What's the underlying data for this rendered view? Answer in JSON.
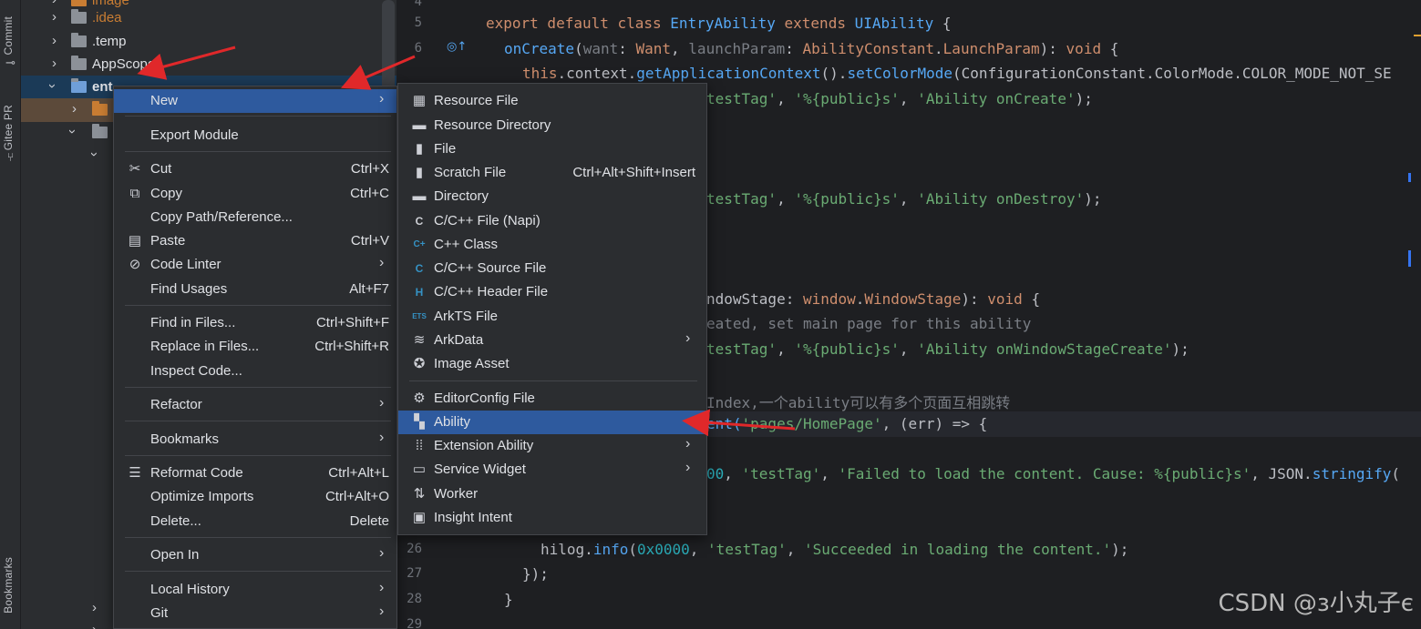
{
  "left_strip": {
    "commit_label": "Commit",
    "gitee_label": "Gitee PR",
    "bookmarks_label": "Bookmarks"
  },
  "project_tree": {
    "items": [
      {
        "label": "image",
        "indent": 1
      },
      {
        "label": ".idea",
        "indent": 1
      },
      {
        "label": ".temp",
        "indent": 1
      },
      {
        "label": "AppScope",
        "indent": 1
      },
      {
        "label": "ent",
        "indent": 1
      }
    ]
  },
  "editor": {
    "line_numbers": [
      "4",
      "5",
      "6",
      "26",
      "27",
      "28",
      "29"
    ],
    "lines": {
      "l5_kw": "export default class ",
      "l5_cls": "EntryAbility",
      "l5_ext": " extends ",
      "l5_base": "UIAbility",
      "l5_end": " {",
      "l6_fn": "onCreate",
      "l6_p1": "want",
      "l6_t1": "Want",
      "l6_p2": "launchParam",
      "l6_t2": "AbilityConstant",
      "l6_t2b": "LaunchParam",
      "l6_void": "void",
      "l7_this": "this",
      "l7_rest": ".context.",
      "l7_fn1": "getApplicationContext",
      "l7_mid": "().",
      "l7_fn2": "setColorMode",
      "l7_arg": "(ConfigurationConstant.ColorMode.COLOR_MODE_NOT_SE",
      "l8_s1": "testTag'",
      "l8_s2": "'%{public}s'",
      "l8_s3": "'Ability onCreate'",
      "l12_s1": "testTag'",
      "l12_s2": "'%{public}s'",
      "l12_s3": "'Ability onDestroy'",
      "l16_p": "ndowStage",
      "l16_t": "window",
      "l16_t2": "WindowStage",
      "l16_void": "void",
      "l17_cmt": "eated, set main page for this ability",
      "l18_s1": "testTag'",
      "l18_s2": "'%{public}s'",
      "l18_s3": "'Ability onWindowStageCreate'",
      "l20_cmt": "Index,一个ability可以有多个页面互相跳转",
      "l21_fn": "ent(",
      "l21_s": "'pages/HomePage'",
      "l21_end": ", (err) => {",
      "l23_num": "00",
      "l23_s1": "'testTag'",
      "l23_s2": "'Failed to load the content. Cause: %{public}s'",
      "l23_json": "JSON",
      "l23_fn": "stringify",
      "l26_obj": "hilog",
      "l26_fn": "info",
      "l26_num": "0x0000",
      "l26_s1": "'testTag'",
      "l26_s2": "'Succeeded in loading the content.'",
      "l27": "});",
      "l28": "}"
    }
  },
  "context_menu": {
    "items": [
      {
        "label": "New",
        "underline": "N",
        "shortcut": "",
        "submenu": true,
        "highlighted": true
      },
      {
        "label": "Export Module",
        "shortcut": ""
      },
      {
        "label": "Cut",
        "shortcut": "Ctrl+X",
        "icon": "scissors-icon"
      },
      {
        "label": "Copy",
        "shortcut": "Ctrl+C",
        "icon": "copy-icon"
      },
      {
        "label": "Copy Path/Reference...",
        "shortcut": ""
      },
      {
        "label": "Paste",
        "shortcut": "Ctrl+V",
        "icon": "clipboard-icon"
      },
      {
        "label": "Code Linter",
        "shortcut": "",
        "submenu": true,
        "icon": "linter-icon"
      },
      {
        "label": "Find Usages",
        "shortcut": "Alt+F7"
      },
      {
        "label": "Find in Files...",
        "shortcut": "Ctrl+Shift+F"
      },
      {
        "label": "Replace in Files...",
        "shortcut": "Ctrl+Shift+R"
      },
      {
        "label": "Inspect Code...",
        "shortcut": ""
      },
      {
        "label": "Refactor",
        "shortcut": "",
        "submenu": true
      },
      {
        "label": "Bookmarks",
        "shortcut": "",
        "submenu": true
      },
      {
        "label": "Reformat Code",
        "shortcut": "Ctrl+Alt+L",
        "icon": "reformat-icon"
      },
      {
        "label": "Optimize Imports",
        "shortcut": "Ctrl+Alt+O"
      },
      {
        "label": "Delete...",
        "shortcut": "Delete"
      },
      {
        "label": "Open In",
        "shortcut": "",
        "submenu": true
      },
      {
        "label": "Local History",
        "shortcut": "",
        "submenu": true
      },
      {
        "label": "Git",
        "shortcut": "",
        "submenu": true
      }
    ]
  },
  "new_submenu": {
    "items": [
      {
        "label": "Resource File",
        "shortcut": "",
        "icon": "resource-file-icon"
      },
      {
        "label": "Resource Directory",
        "shortcut": "",
        "icon": "folder-icon"
      },
      {
        "label": "File",
        "shortcut": "",
        "icon": "file-icon"
      },
      {
        "label": "Scratch File",
        "shortcut": "Ctrl+Alt+Shift+Insert",
        "icon": "scratch-file-icon"
      },
      {
        "label": "Directory",
        "shortcut": "",
        "icon": "folder-icon"
      },
      {
        "label": "C/C++ File (Napi)",
        "shortcut": "",
        "icon": "c-file-icon"
      },
      {
        "label": "C++ Class",
        "shortcut": "",
        "icon": "cpp-class-icon"
      },
      {
        "label": "C/C++ Source File",
        "shortcut": "",
        "icon": "c-source-icon"
      },
      {
        "label": "C/C++ Header File",
        "shortcut": "",
        "icon": "c-header-icon"
      },
      {
        "label": "ArkTS File",
        "shortcut": "",
        "icon": "ets-file-icon"
      },
      {
        "label": "ArkData",
        "shortcut": "",
        "submenu": true,
        "icon": "database-icon"
      },
      {
        "label": "Image Asset",
        "shortcut": "",
        "icon": "image-asset-icon"
      },
      {
        "label": "EditorConfig File",
        "shortcut": "",
        "icon": "gear-icon"
      },
      {
        "label": "Ability",
        "shortcut": "",
        "highlighted": true,
        "icon": "ability-icon"
      },
      {
        "label": "Extension Ability",
        "shortcut": "",
        "submenu": true,
        "icon": "extension-icon"
      },
      {
        "label": "Service Widget",
        "shortcut": "",
        "submenu": true,
        "icon": "widget-icon"
      },
      {
        "label": "Worker",
        "shortcut": "",
        "icon": "worker-icon"
      },
      {
        "label": "Insight Intent",
        "shortcut": "",
        "icon": "intent-icon"
      }
    ]
  },
  "watermark": "CSDN @з小丸子є",
  "colors": {
    "menu_bg": "#2b2d30",
    "highlight": "#2e5a9e",
    "annotation_arrow": "#e0282a"
  }
}
